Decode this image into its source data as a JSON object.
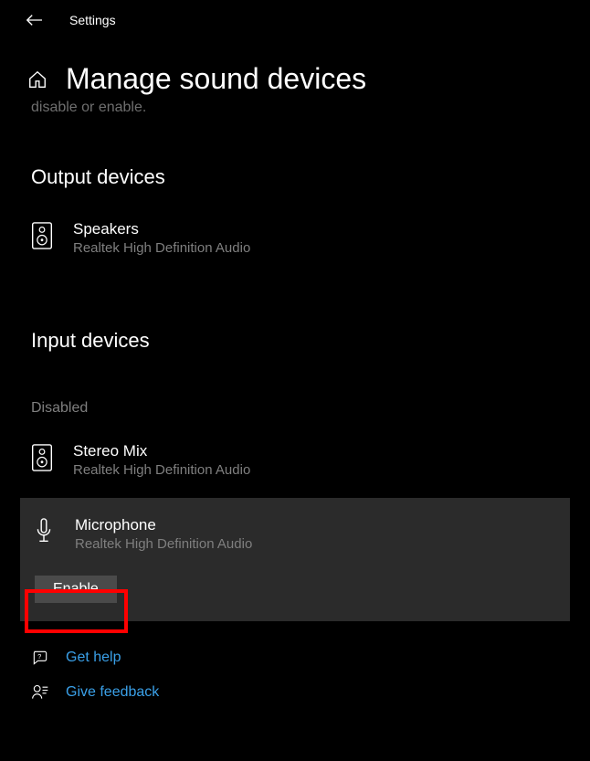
{
  "top": {
    "settings_label": "Settings"
  },
  "header": {
    "page_title": "Manage sound devices",
    "truncated_line": "disable or enable."
  },
  "sections": {
    "output_heading": "Output devices",
    "input_heading": "Input devices",
    "disabled_subheading": "Disabled"
  },
  "devices": {
    "speakers": {
      "name": "Speakers",
      "driver": "Realtek High Definition Audio"
    },
    "stereo_mix": {
      "name": "Stereo Mix",
      "driver": "Realtek High Definition Audio"
    },
    "microphone": {
      "name": "Microphone",
      "driver": "Realtek High Definition Audio"
    }
  },
  "buttons": {
    "enable": "Enable"
  },
  "footer": {
    "help": "Get help",
    "feedback": "Give feedback"
  }
}
